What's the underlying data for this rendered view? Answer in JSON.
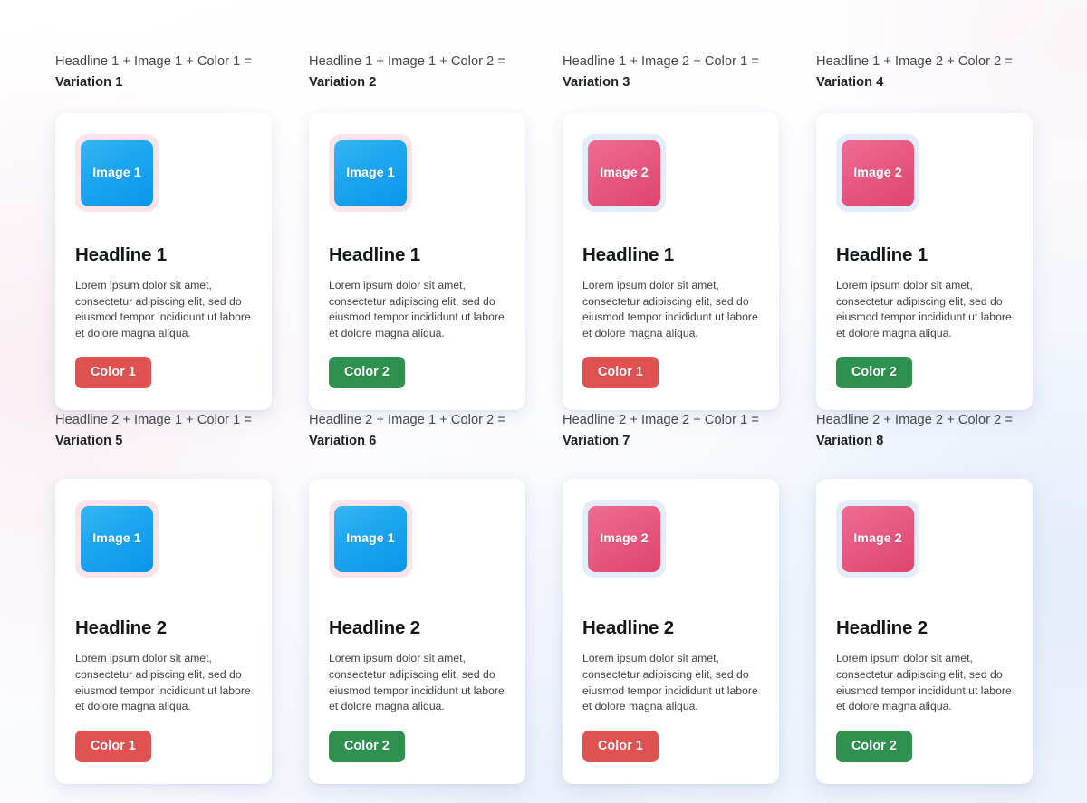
{
  "shared": {
    "body_text": "Lorem ipsum dolor sit amet, consectetur adipiscing elit, sed do eiusmod tempor incididunt ut labore et dolore magna aliqua.",
    "colors": {
      "color_1": "#e05252",
      "color_2": "#2e9150",
      "image_1_gradient_start": "#36b6f2",
      "image_1_gradient_end": "#0a95ea",
      "image_1_glow": "#fae4ea",
      "image_2_gradient_start": "#ef6d92",
      "image_2_gradient_end": "#de4470",
      "image_2_glow": "#e3ecf9",
      "card_background": "#ffffff",
      "headline_text": "#14171a",
      "body_text": "#3e4349",
      "caption_formula": "#44484d",
      "caption_variation": "#1d2024"
    }
  },
  "cards": [
    {
      "formula": "Headline 1 + Image 1 + Color 1 =",
      "variation": "Variation 1",
      "image_label": "Image 1",
      "image_style": "blue",
      "glow_style": "pink",
      "headline": "Headline 1",
      "body": "Lorem ipsum dolor sit amet, consectetur adipiscing elit, sed do eiusmod tempor incididunt ut labore et dolore magna aliqua.",
      "button_label": "Color 1",
      "button_style": "color-1"
    },
    {
      "formula": "Headline 1 + Image 1 + Color 2 =",
      "variation": "Variation 2",
      "image_label": "Image 1",
      "image_style": "blue",
      "glow_style": "pink",
      "headline": "Headline 1",
      "body": "Lorem ipsum dolor sit amet, consectetur adipiscing elit, sed do eiusmod tempor incididunt ut labore et dolore magna aliqua.",
      "button_label": "Color 2",
      "button_style": "color-2"
    },
    {
      "formula": "Headline 1 + Image 2 + Color 1 =",
      "variation": "Variation 3",
      "image_label": "Image 2",
      "image_style": "rose",
      "glow_style": "blue",
      "headline": "Headline 1",
      "body": "Lorem ipsum dolor sit amet, consectetur adipiscing elit, sed do eiusmod tempor incididunt ut labore et dolore magna aliqua.",
      "button_label": "Color 1",
      "button_style": "color-1"
    },
    {
      "formula": "Headline 1 + Image 2 + Color 2 =",
      "variation": "Variation 4",
      "image_label": "Image 2",
      "image_style": "rose",
      "glow_style": "blue",
      "headline": "Headline 1",
      "body": "Lorem ipsum dolor sit amet, consectetur adipiscing elit, sed do eiusmod tempor incididunt ut labore et dolore magna aliqua.",
      "button_label": "Color 2",
      "button_style": "color-2"
    },
    {
      "formula": "Headline 2 + Image 1 + Color 1 =",
      "variation": "Variation 5",
      "image_label": "Image 1",
      "image_style": "blue",
      "glow_style": "pink",
      "headline": "Headline 2",
      "body": "Lorem ipsum dolor sit amet, consectetur adipiscing elit, sed do eiusmod tempor incididunt ut labore et dolore magna aliqua.",
      "button_label": "Color 1",
      "button_style": "color-1"
    },
    {
      "formula": "Headline 2 + Image 1 + Color 2 =",
      "variation": "Variation 6",
      "image_label": "Image 1",
      "image_style": "blue",
      "glow_style": "pink",
      "headline": "Headline 2",
      "body": "Lorem ipsum dolor sit amet, consectetur adipiscing elit, sed do eiusmod tempor incididunt ut labore et dolore magna aliqua.",
      "button_label": "Color 2",
      "button_style": "color-2"
    },
    {
      "formula": "Headline 2 + Image 2 + Color 1 =",
      "variation": "Variation 7",
      "image_label": "Image 2",
      "image_style": "rose",
      "glow_style": "blue",
      "headline": "Headline 2",
      "body": "Lorem ipsum dolor sit amet, consectetur adipiscing elit, sed do eiusmod tempor incididunt ut labore et dolore magna aliqua.",
      "button_label": "Color 1",
      "button_style": "color-1"
    },
    {
      "formula": "Headline 2 + Image 2 + Color 2 =",
      "variation": "Variation 8",
      "image_label": "Image 2",
      "image_style": "rose",
      "glow_style": "blue",
      "headline": "Headline 2",
      "body": "Lorem ipsum dolor sit amet, consectetur adipiscing elit, sed do eiusmod tempor incididunt ut labore et dolore magna aliqua.",
      "button_label": "Color 2",
      "button_style": "color-2"
    }
  ]
}
